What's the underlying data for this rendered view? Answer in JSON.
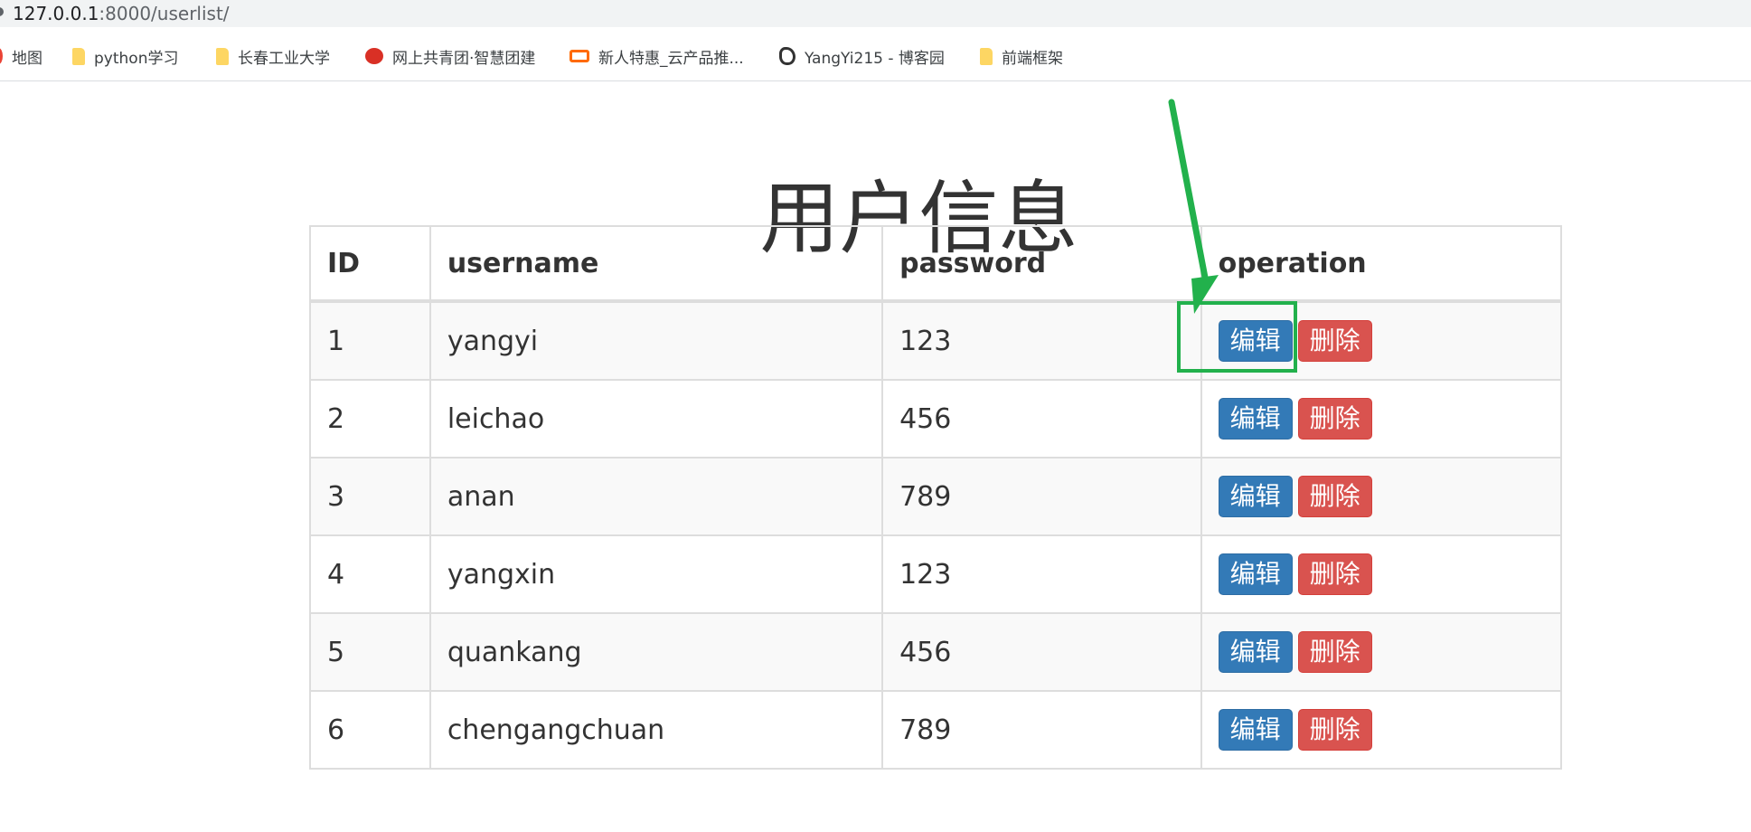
{
  "browser": {
    "url_host": "127.0.0.1",
    "url_path": ":8000/userlist/",
    "bookmarks": [
      {
        "label": "地图",
        "icon": "map-pin-icon"
      },
      {
        "label": "python学习",
        "icon": "folder-icon"
      },
      {
        "label": "长春工业大学",
        "icon": "folder-icon"
      },
      {
        "label": "网上共青团·智慧团建",
        "icon": "league-flag-icon"
      },
      {
        "label": "新人特惠_云产品推...",
        "icon": "aliyun-cloud-icon"
      },
      {
        "label": "YangYi215 - 博客园",
        "icon": "cnblogs-icon"
      },
      {
        "label": "前端框架",
        "icon": "folder-icon"
      }
    ]
  },
  "page": {
    "title": "用户信息"
  },
  "table": {
    "headers": [
      "ID",
      "username",
      "password",
      "operation"
    ],
    "rows": [
      {
        "id": "1",
        "username": "yangyi",
        "password": "123"
      },
      {
        "id": "2",
        "username": "leichao",
        "password": "456"
      },
      {
        "id": "3",
        "username": "anan",
        "password": "789"
      },
      {
        "id": "4",
        "username": "yangxin",
        "password": "123"
      },
      {
        "id": "5",
        "username": "quankang",
        "password": "456"
      },
      {
        "id": "6",
        "username": "chengangchuan",
        "password": "789"
      }
    ],
    "edit_label": "编辑",
    "delete_label": "删除"
  },
  "annotation": {
    "color": "#22b14c"
  }
}
